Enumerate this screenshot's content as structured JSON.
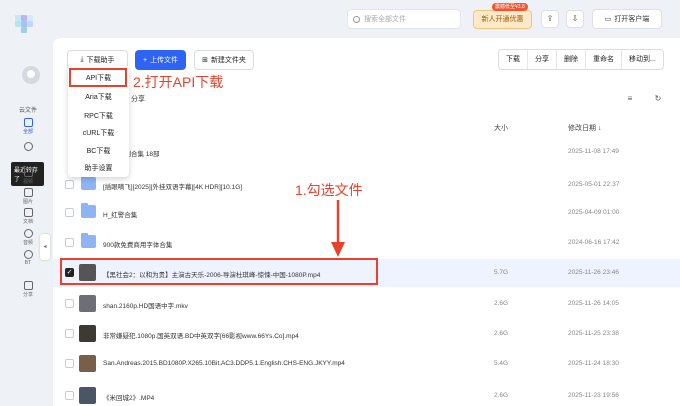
{
  "sidebar": {
    "section_label": "云文件",
    "items": [
      {
        "label": "全部",
        "icon": "folder-icon",
        "active": true
      },
      {
        "label": "最近转存了",
        "icon": "clock-icon",
        "active": false
      },
      {
        "label": "视频",
        "icon": "video-icon",
        "active": false
      },
      {
        "label": "图片",
        "icon": "image-icon",
        "active": false
      },
      {
        "label": "文档",
        "icon": "document-icon",
        "active": false
      },
      {
        "label": "音频",
        "icon": "audio-icon",
        "active": false
      },
      {
        "label": "BT",
        "icon": "magnet-icon",
        "active": false
      },
      {
        "label": "分享",
        "icon": "share-icon",
        "active": false
      }
    ],
    "tooltip": "最近转存了"
  },
  "header": {
    "search_placeholder": "搜索全部文件",
    "promo_label": "新人开通优惠",
    "promo_badge": "震撼低至¥3.8",
    "client_button": "打开客户端"
  },
  "toolbar": {
    "download_helper": "下载助手",
    "upload": "上传文件",
    "new_folder": "新建文件夹",
    "actions": [
      "下载",
      "分享",
      "删除",
      "重命名",
      "移动到..."
    ]
  },
  "dropdown": {
    "items": [
      "API下载",
      "Aria下载",
      "RPC下载",
      "cURL下载",
      "BC下载",
      "助手设置"
    ]
  },
  "annotations": {
    "step2": "2.打开API下载",
    "step1": "1.勾选文件"
  },
  "breadcrumb": "分享",
  "table": {
    "headers": {
      "size": "大小",
      "modified": "修改日期"
    },
    "rows": [
      {
        "name": "电影系列合集 18部",
        "size": "",
        "date": "2025-11-08 17:49",
        "type": "folder",
        "checked": false
      },
      {
        "name": "[插眼嘀飞][2025][外挂双语字幕][4K HDR][10.1G]",
        "size": "",
        "date": "2025-05-01 22:37",
        "type": "folder",
        "checked": false
      },
      {
        "name": "H_红警合集",
        "size": "",
        "date": "2025-04-09 01:00",
        "type": "folder",
        "checked": false
      },
      {
        "name": "900款免费商用字体合集",
        "size": "",
        "date": "2024-06-16 17:42",
        "type": "folder",
        "checked": false
      },
      {
        "name": "【黑社会2：以和为贵】主演古天乐-2006-导演杜琪峰-惊悚-中国-1080P.mp4",
        "size": "5.7G",
        "date": "2025-11-26 23:46",
        "type": "video",
        "checked": true
      },
      {
        "name": "shan.2160p.HD国语中字.mkv",
        "size": "2.6G",
        "date": "2025-11-26 14:05",
        "type": "video",
        "checked": false
      },
      {
        "name": "非常嫌疑犯.1080p.国英双语.BD中英双字[66影视www.66Ys.Co].mp4",
        "size": "2.6G",
        "date": "2025-11-25 23:38",
        "type": "video",
        "checked": false
      },
      {
        "name": "San.Andreas.2015.BD1080P.X265.10Bit.AC3.DDP5.1.English.CHS-ENG.JKYY.mp4",
        "size": "5.4G",
        "date": "2025-11-24 18:30",
        "type": "video",
        "checked": false
      },
      {
        "name": "《米回城2》.MP4",
        "size": "2.6G",
        "date": "2025-11-23 19:56",
        "type": "video",
        "checked": false
      }
    ]
  },
  "colors": {
    "accent": "#2f63f3",
    "annotation": "#e8412c",
    "promo": "#ffe9c9"
  }
}
